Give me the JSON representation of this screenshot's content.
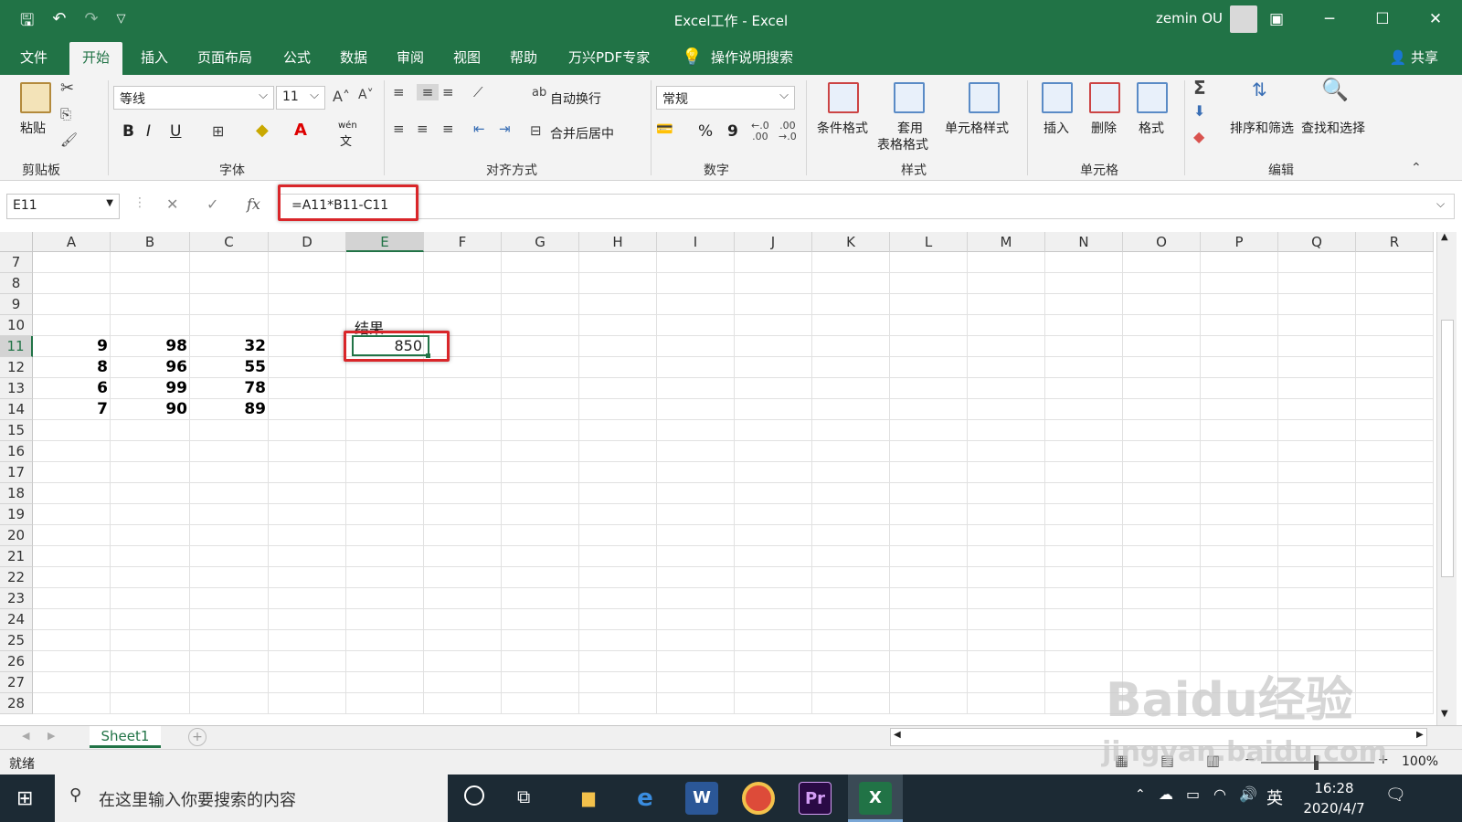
{
  "title_bar": {
    "title": "Excel工作 - Excel",
    "user": "zemin OU",
    "accent": "#217346"
  },
  "tabs": [
    "文件",
    "开始",
    "插入",
    "页面布局",
    "公式",
    "数据",
    "审阅",
    "视图",
    "帮助",
    "万兴PDF专家"
  ],
  "active_tab": "开始",
  "tell_me": "操作说明搜索",
  "share": "共享",
  "ribbon": {
    "clipboard": {
      "paste": "粘贴",
      "label": "剪贴板"
    },
    "font": {
      "name": "等线",
      "size": "11",
      "label": "字体",
      "bold": "B",
      "italic": "I",
      "underline": "U",
      "wen": "wén",
      "wen_char": "文"
    },
    "alignment": {
      "wrap": "自动换行",
      "merge": "合并后居中",
      "label": "对齐方式"
    },
    "number": {
      "format": "常规",
      "percent": "%",
      "comma": "9",
      "label": "数字"
    },
    "styles": {
      "conditional": "条件格式",
      "table_line1": "套用",
      "table_line2": "表格格式",
      "cell_styles": "单元格样式",
      "label": "样式"
    },
    "cells": {
      "insert": "插入",
      "delete": "删除",
      "format": "格式",
      "label": "单元格"
    },
    "editing": {
      "sort": "排序和筛选",
      "find": "查找和选择",
      "label": "编辑"
    }
  },
  "formula_bar": {
    "name_box": "E11",
    "fx": "fx",
    "formula": "=A11*B11-C11"
  },
  "grid": {
    "columns": [
      "A",
      "B",
      "C",
      "D",
      "E",
      "F",
      "G",
      "H",
      "I",
      "J",
      "K",
      "L",
      "M",
      "N",
      "O",
      "P",
      "Q",
      "R"
    ],
    "rows": [
      "7",
      "8",
      "9",
      "10",
      "11",
      "12",
      "13",
      "14",
      "15",
      "16",
      "17",
      "18",
      "19",
      "20",
      "21",
      "22",
      "23",
      "24",
      "25",
      "26",
      "27",
      "28"
    ],
    "selected_col": "E",
    "selected_row": "11",
    "e10_label": "结果",
    "e11_value": "850",
    "data": [
      [
        "9",
        "98",
        "32"
      ],
      [
        "8",
        "96",
        "55"
      ],
      [
        "6",
        "99",
        "78"
      ],
      [
        "7",
        "90",
        "89"
      ]
    ]
  },
  "sheet_tab": "Sheet1",
  "status": {
    "ready": "就绪",
    "zoom": "100%"
  },
  "taskbar": {
    "search_placeholder": "在这里输入你要搜索的内容",
    "ime": "英",
    "time": "16:28",
    "date": "2020/4/7",
    "apps": [
      "file-explorer",
      "edge",
      "word",
      "chrome",
      "premiere",
      "excel"
    ]
  },
  "watermark": {
    "line1": "Baidu经验",
    "line2": "jingyan.baidu.com"
  }
}
